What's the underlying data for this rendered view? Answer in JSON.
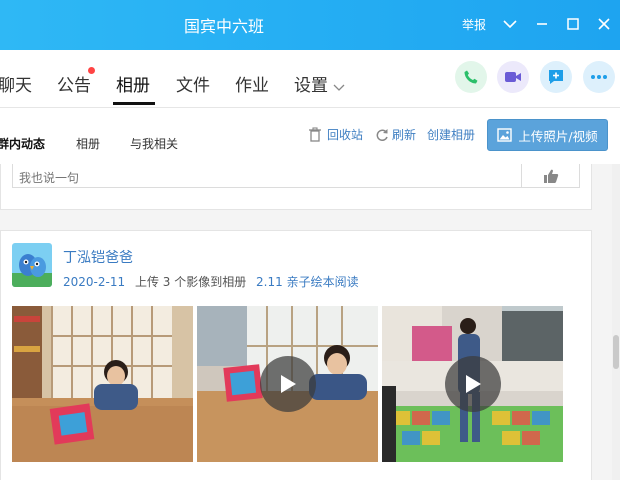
{
  "window": {
    "title": "国宾中六班",
    "report_label": "举报",
    "accent": "#25aef3"
  },
  "tabs": [
    {
      "label": "聊天",
      "active": false
    },
    {
      "label": "公告",
      "active": false,
      "has_badge": true
    },
    {
      "label": "相册",
      "active": true
    },
    {
      "label": "文件",
      "active": false
    },
    {
      "label": "作业",
      "active": false
    },
    {
      "label": "设置",
      "active": false,
      "has_dropdown": true
    }
  ],
  "quick_actions": [
    "phone-call-icon",
    "video-call-icon",
    "add-message-icon",
    "more-icon"
  ],
  "subtabs": [
    {
      "label": "群内动态",
      "active": true
    },
    {
      "label": "相册",
      "active": false
    },
    {
      "label": "与我相关",
      "active": false
    }
  ],
  "toolbar": {
    "recycle_label": "回收站",
    "refresh_label": "刷新",
    "create_album_label": "创建相册",
    "upload_label": "上传照片/视频"
  },
  "comment": {
    "placeholder": "我也说一句"
  },
  "post": {
    "author": "丁泓铠爸爸",
    "date": "2020-2-11",
    "action_text": "上传 3 个影像到相册",
    "album": "2.11 亲子绘本阅读",
    "media": [
      {
        "type": "photo"
      },
      {
        "type": "video"
      },
      {
        "type": "video"
      }
    ]
  }
}
